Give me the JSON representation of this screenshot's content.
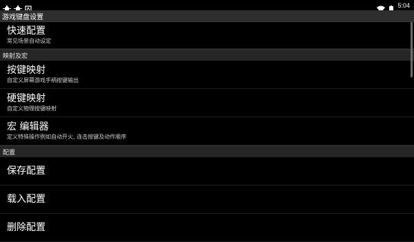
{
  "status_bar": {
    "time": "5:04",
    "left_icons": [
      "bug-icon",
      "bug-icon",
      "notification-icon"
    ],
    "right_icons": [
      "wifi-icon",
      "battery-icon"
    ]
  },
  "title": "游戏键盘设置",
  "sections": [
    {
      "header": "",
      "items": [
        {
          "title": "快速配置",
          "subtitle": "常见场景自动设定"
        }
      ]
    },
    {
      "header": "映射及宏",
      "items": [
        {
          "title": "按键映射",
          "subtitle": "自定义屏幕游戏手柄按键输出"
        },
        {
          "title": "硬键映射",
          "subtitle": "自定义物理按键映射"
        },
        {
          "title": "宏 编辑器",
          "subtitle": "定义特殊操作例如自动开火, 连击按键及动作顺序"
        }
      ]
    },
    {
      "header": "配置",
      "items": [
        {
          "title": "保存配置",
          "subtitle": ""
        },
        {
          "title": "载入配置",
          "subtitle": ""
        },
        {
          "title": "删除配置",
          "subtitle": ""
        }
      ]
    }
  ]
}
